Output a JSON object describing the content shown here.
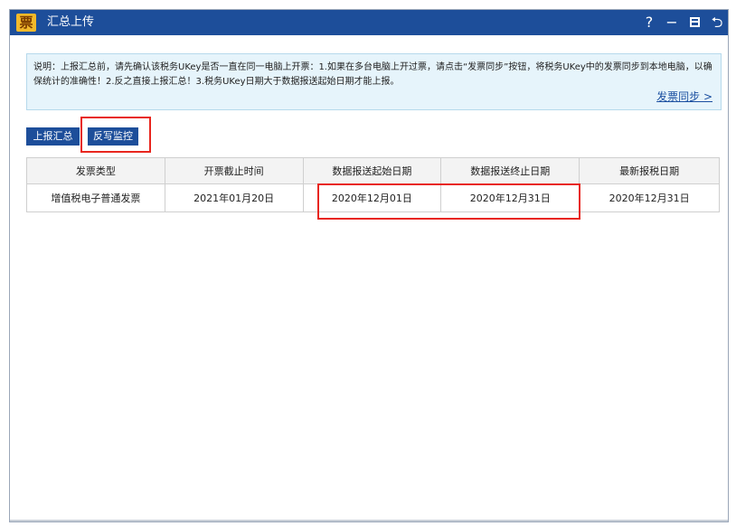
{
  "window": {
    "title": "汇总上传",
    "app_icon_glyph": "票",
    "controls": {
      "help": "?",
      "minimize": "−",
      "back": "⮌"
    }
  },
  "notice": {
    "text": "说明：上报汇总前，请先确认该税务UKey是否一直在同一电脑上开票：1.如果在多台电脑上开过票，请点击“发票同步”按钮，将税务UKey中的发票同步到本地电脑，以确保统计的准确性！2.反之直接上报汇总！3.税务UKey日期大于数据报送起始日期才能上报。",
    "sync_link": "发票同步 >"
  },
  "toolbar": {
    "upload_summary": "上报汇总",
    "writeback_monitor": "反写监控"
  },
  "table": {
    "headers": [
      "发票类型",
      "开票截止时间",
      "数据报送起始日期",
      "数据报送终止日期",
      "最新报税日期"
    ],
    "rows": [
      [
        "增值税电子普通发票",
        "2021年01月20日",
        "2020年12月01日",
        "2020年12月31日",
        "2020年12月31日"
      ]
    ]
  },
  "colors": {
    "titlebar": "#1d4e9a",
    "highlight": "#e8261e",
    "notice_bg": "#e6f4fb",
    "button": "#1d4e9a"
  }
}
